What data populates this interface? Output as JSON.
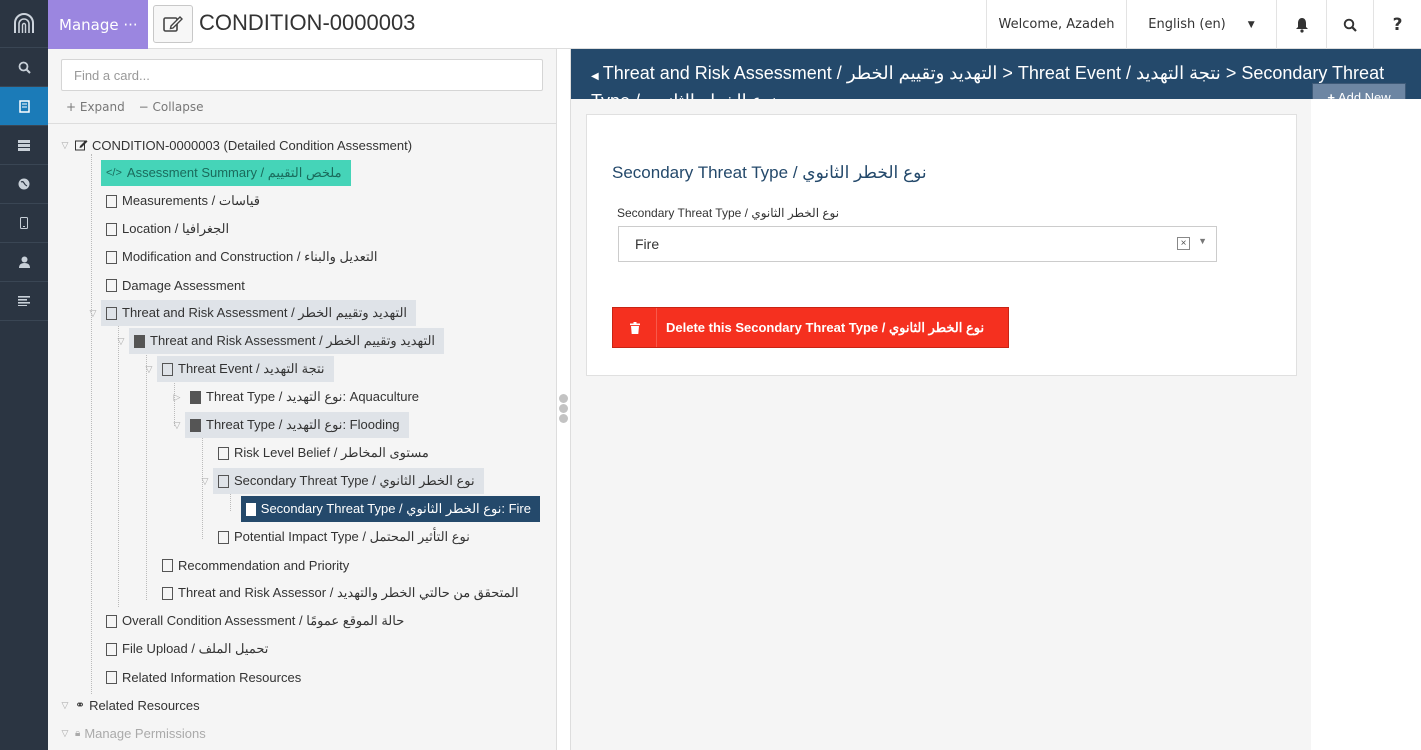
{
  "topbar": {
    "manage_label": "Manage ···",
    "page_title": "CONDITION-0000003",
    "welcome": "Welcome, Azadeh",
    "language": "English (en)",
    "help": "?"
  },
  "tree": {
    "search_placeholder": "Find a card...",
    "expand_label": "Expand",
    "collapse_label": "Collapse",
    "nodes": [
      "CONDITION-0000003 (Detailed Condition Assessment)",
      "Assessment Summary / ملخص التقييم",
      "Measurements / قياسات",
      "Location / الجغرافيا",
      "Modification and Construction / التعديل والبناء",
      "Damage Assessment",
      "Threat and Risk Assessment / التهديد وتقييم الخطر",
      "Threat and Risk Assessment / التهديد وتقييم الخطر",
      "Threat Event / نتجة التهديد",
      "Threat Type / نوع التهديد: Aquaculture",
      "Threat Type / نوع التهديد: Flooding",
      "Risk Level Belief / مستوى المخاطر",
      "Secondary Threat Type / نوع الخطر الثانوي",
      "Secondary Threat Type / نوع الخطر الثانوي: Fire",
      "Potential Impact Type / نوع التأثير المحتمل",
      "Recommendation and Priority",
      "Threat and Risk Assessor / المتحقق من حالتي الخطر والتهديد",
      "Overall Condition Assessment / حالة الموقع عمومًا",
      "File Upload / تحميل الملف",
      "Related Information Resources",
      "Related Resources",
      "Manage Permissions"
    ]
  },
  "main": {
    "breadcrumb": "Threat and Risk Assessment / التهديد وتقييم الخطر > Threat Event / نتجة التهديد > Secondary Threat Type / نوع الخطر الثانوي",
    "add_new_label": "Add New",
    "card_title": "Secondary Threat Type / نوع الخطر الثانوي",
    "field_label": "Secondary Threat Type / نوع الخطر الثانوي",
    "field_value": "Fire",
    "delete_label": "Delete this Secondary Threat Type / نوع الخطر الثانوي"
  },
  "icons": {
    "rail": [
      "logo-icon",
      "search-icon",
      "book-icon",
      "list-icon",
      "globe-icon",
      "mobile-icon",
      "user-icon",
      "menu-icon"
    ]
  },
  "colors": {
    "rail_bg": "#2b3542",
    "rail_active": "#1b7bb8",
    "manage_bg": "#9b86e0",
    "header_blue": "#24496b",
    "assessment_green": "#45d4b8",
    "delete_red": "#f5301f"
  }
}
